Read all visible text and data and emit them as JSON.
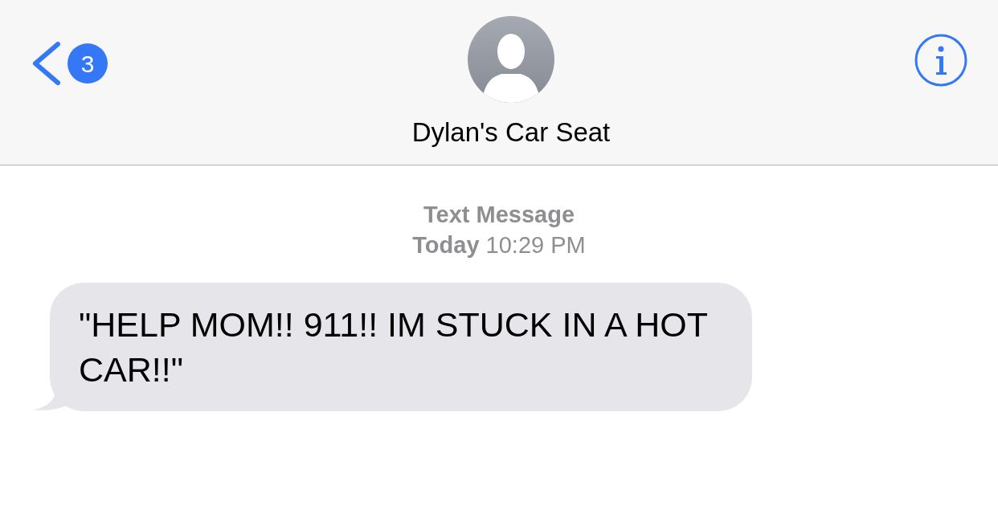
{
  "header": {
    "back_badge": "3",
    "contact_name": "Dylan's Car Seat"
  },
  "thread": {
    "service": "Text Message",
    "timestamp": "**Today** 10:29 PM",
    "messages": [
      {
        "kind": "incoming",
        "text": "\"HELP MOM!! 911!! IM STUCK IN A HOT CAR!!\""
      }
    ]
  }
}
